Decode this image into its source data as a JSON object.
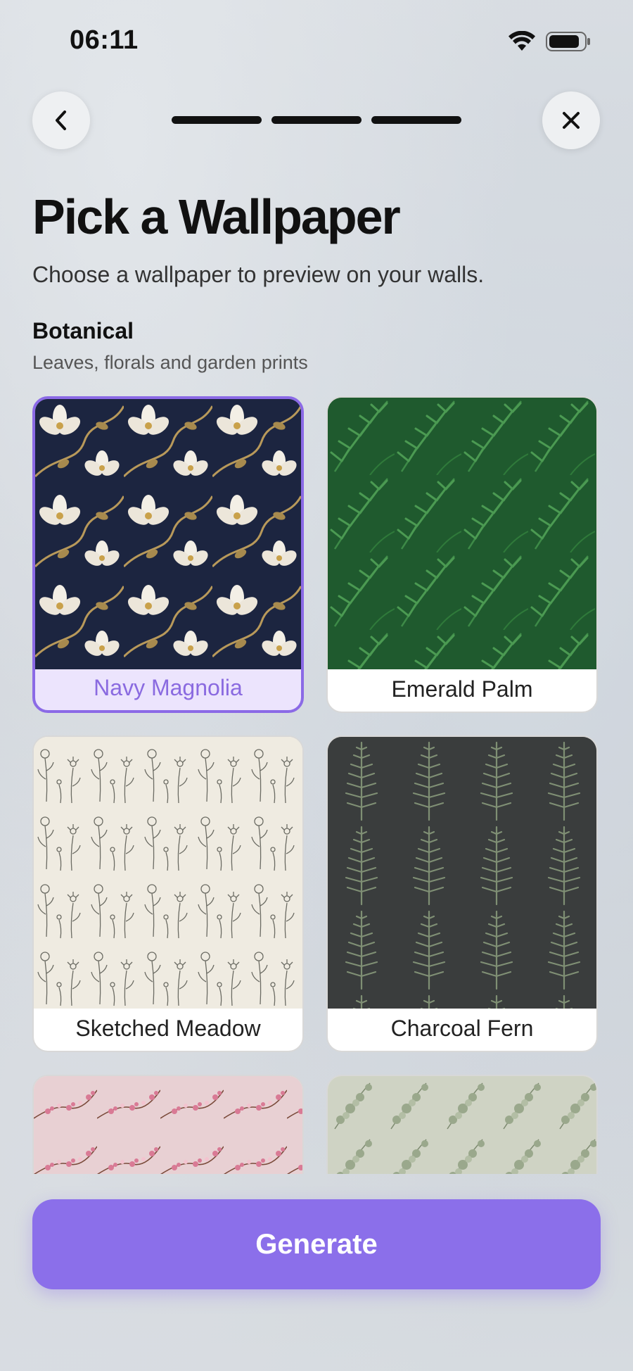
{
  "status": {
    "time": "06:11"
  },
  "header": {
    "progress_steps": 3
  },
  "title": "Pick a Wallpaper",
  "subtitle": "Choose a wallpaper to preview on your walls.",
  "section": {
    "title": "Botanical",
    "subtitle": "Leaves, florals and garden prints"
  },
  "wallpapers": [
    {
      "name": "Navy Magnolia",
      "selected": true,
      "pattern": "navy-magnolia"
    },
    {
      "name": "Emerald Palm",
      "selected": false,
      "pattern": "emerald-palm"
    },
    {
      "name": "Sketched Meadow",
      "selected": false,
      "pattern": "sketched-meadow"
    },
    {
      "name": "Charcoal Fern",
      "selected": false,
      "pattern": "charcoal-fern"
    },
    {
      "name": "",
      "selected": false,
      "pattern": "pink-blossom"
    },
    {
      "name": "",
      "selected": false,
      "pattern": "sage-eucalyptus"
    }
  ],
  "cta": {
    "label": "Generate"
  },
  "colors": {
    "accent": "#8b6fea",
    "selected_bg": "#ece4fd"
  }
}
